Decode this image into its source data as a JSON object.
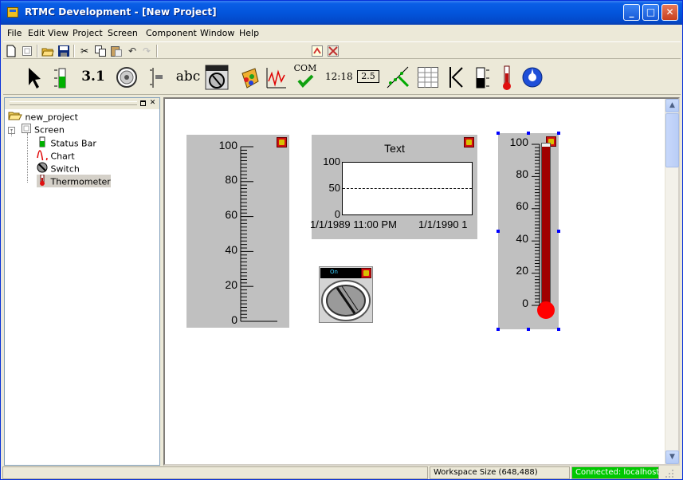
{
  "window": {
    "title": "RTMC Development - [New Project]"
  },
  "titlebar_buttons": {
    "minimize": "_",
    "maximize": "□",
    "close": "✕"
  },
  "menu": [
    "File",
    "Edit",
    "View",
    "Project",
    "Screen",
    "Component",
    "Window",
    "Help"
  ],
  "toolbar1": {
    "icons": [
      "new-icon",
      "properties-icon",
      "open-icon",
      "save-icon",
      "cut-icon",
      "copy-icon",
      "paste-icon",
      "undo-icon",
      "redo-icon",
      "component-library-icon",
      "tools-icon"
    ]
  },
  "toolbar2": {
    "labels": {
      "digits": "3.1",
      "abc": "abc",
      "com": "COM",
      "time": "12:18",
      "box": "2.5"
    },
    "icons": [
      "pointer-icon",
      "status-bar-icon",
      "digits-icon",
      "dial-icon",
      "slider-icon",
      "text-icon",
      "switch-icon",
      "paint-icon",
      "chart-icon",
      "com-status-icon",
      "time-icon",
      "number-box-icon",
      "xy-chart-icon",
      "table-icon",
      "alarm-icon",
      "level-icon",
      "thermometer-icon",
      "compass-icon"
    ]
  },
  "tree": {
    "root": "new_project",
    "screen": "Screen",
    "items": [
      "Status Bar",
      "Chart",
      "Switch",
      "Thermometer"
    ]
  },
  "components": {
    "status_bar": {
      "ticks": [
        "100",
        "80",
        "60",
        "40",
        "20",
        "0"
      ]
    },
    "chart": {
      "title": "Text",
      "y_ticks": [
        "100",
        "50",
        "0"
      ],
      "x_ticks": [
        "1/1/1989 11:00 PM",
        "1/1/1990 1"
      ]
    },
    "switch": {
      "label": "On"
    },
    "thermometer": {
      "ticks": [
        "100",
        "80",
        "60",
        "40",
        "20",
        "0"
      ]
    }
  },
  "status": {
    "workspace": "Workspace Size (648,488)",
    "connection": "Connected: localhost",
    "connection_color": "#00c800"
  }
}
